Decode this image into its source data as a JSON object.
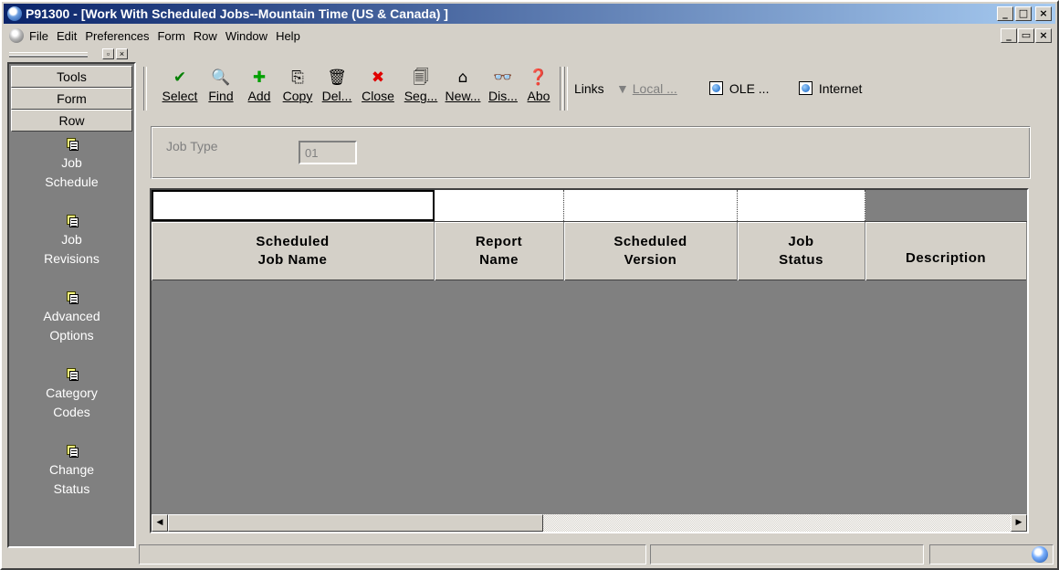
{
  "window": {
    "title": "P91300 - [Work With Scheduled Jobs--Mountain Time (US & Canada)  ]",
    "minimize": "_",
    "maximize": "□",
    "close": "×",
    "restore": "▭"
  },
  "menubar": {
    "items": [
      "File",
      "Edit",
      "Preferences",
      "Form",
      "Row",
      "Window",
      "Help"
    ]
  },
  "exitbar": {
    "buttons": [
      "Tools",
      "Form",
      "Row"
    ],
    "items": [
      {
        "label": "Job\nSchedule",
        "icon": "row-exit-icon"
      },
      {
        "label": "Job\nRevisions",
        "icon": "row-exit-icon"
      },
      {
        "label": "Advanced\nOptions",
        "icon": "row-exit-icon"
      },
      {
        "label": "Category\nCodes",
        "icon": "row-exit-icon"
      },
      {
        "label": "Change\nStatus",
        "icon": "row-exit-icon"
      }
    ]
  },
  "toolbar": {
    "buttons": [
      {
        "label": "Select",
        "icon": "✔",
        "color": "#008000"
      },
      {
        "label": "Find",
        "icon": "🔍",
        "color": "#000000"
      },
      {
        "label": "Add",
        "icon": "✚",
        "color": "#00a000"
      },
      {
        "label": "Copy",
        "icon": "⎘",
        "color": "#000000"
      },
      {
        "label": "Del...",
        "icon": "🗑",
        "color": "#000000"
      },
      {
        "label": "Close",
        "icon": "✖",
        "color": "#e00000"
      },
      {
        "label": "Seg...",
        "icon": "🗐",
        "color": "#000000"
      },
      {
        "label": "New...",
        "icon": "⌂",
        "color": "#000000"
      },
      {
        "label": "Dis...",
        "icon": "👓",
        "color": "#c00000"
      },
      {
        "label": "Abo",
        "icon": "❓",
        "color": "#000080"
      }
    ],
    "links_label": "Links",
    "local_label": "Local ...",
    "ole_label": "OLE ...",
    "internet_label": "Internet"
  },
  "filter": {
    "job_type_label": "Job Type",
    "job_type_value": "01"
  },
  "grid": {
    "columns": [
      "Scheduled\nJob Name",
      "Report\nName",
      "Scheduled\nVersion",
      "Job\nStatus",
      "Description"
    ],
    "rows": []
  },
  "colors": {
    "face": "#d4d0c8",
    "grid_background": "#808080",
    "title_start": "#0a246a",
    "title_end": "#a6caf0"
  }
}
